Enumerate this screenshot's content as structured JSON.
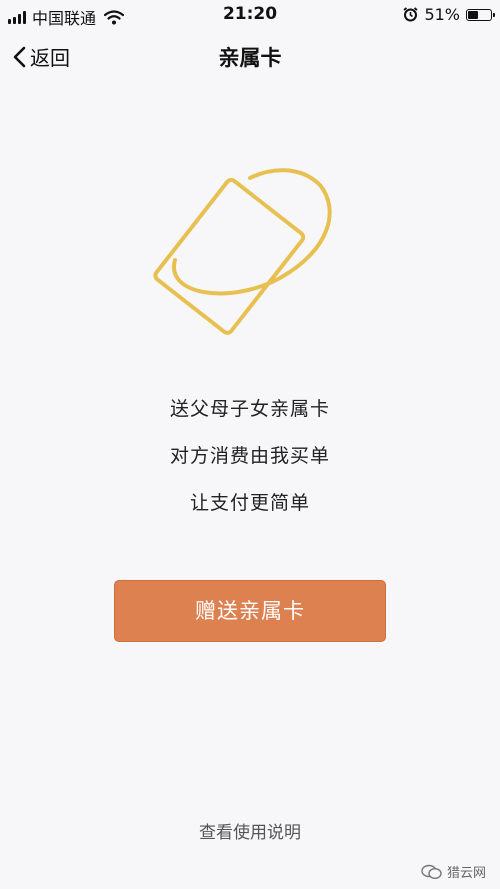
{
  "status_bar": {
    "carrier": "中国联通",
    "time": "21:20",
    "battery_percent": "51%",
    "battery_level": 0.51,
    "icons": [
      "signal-icon",
      "wifi-icon",
      "alarm-icon",
      "battery-icon"
    ]
  },
  "nav": {
    "back_label": "返回",
    "title": "亲属卡"
  },
  "main": {
    "lines": [
      "送父母子女亲属卡",
      "对方消费由我买单",
      "让支付更简单"
    ],
    "gift_button_label": "赠送亲属卡",
    "help_link": "查看使用说明"
  },
  "watermark": {
    "text": "猎云网"
  },
  "colors": {
    "accent_button": "#dd8150",
    "illustration_gold": "#e8c051",
    "background": "#f7f7f9"
  }
}
